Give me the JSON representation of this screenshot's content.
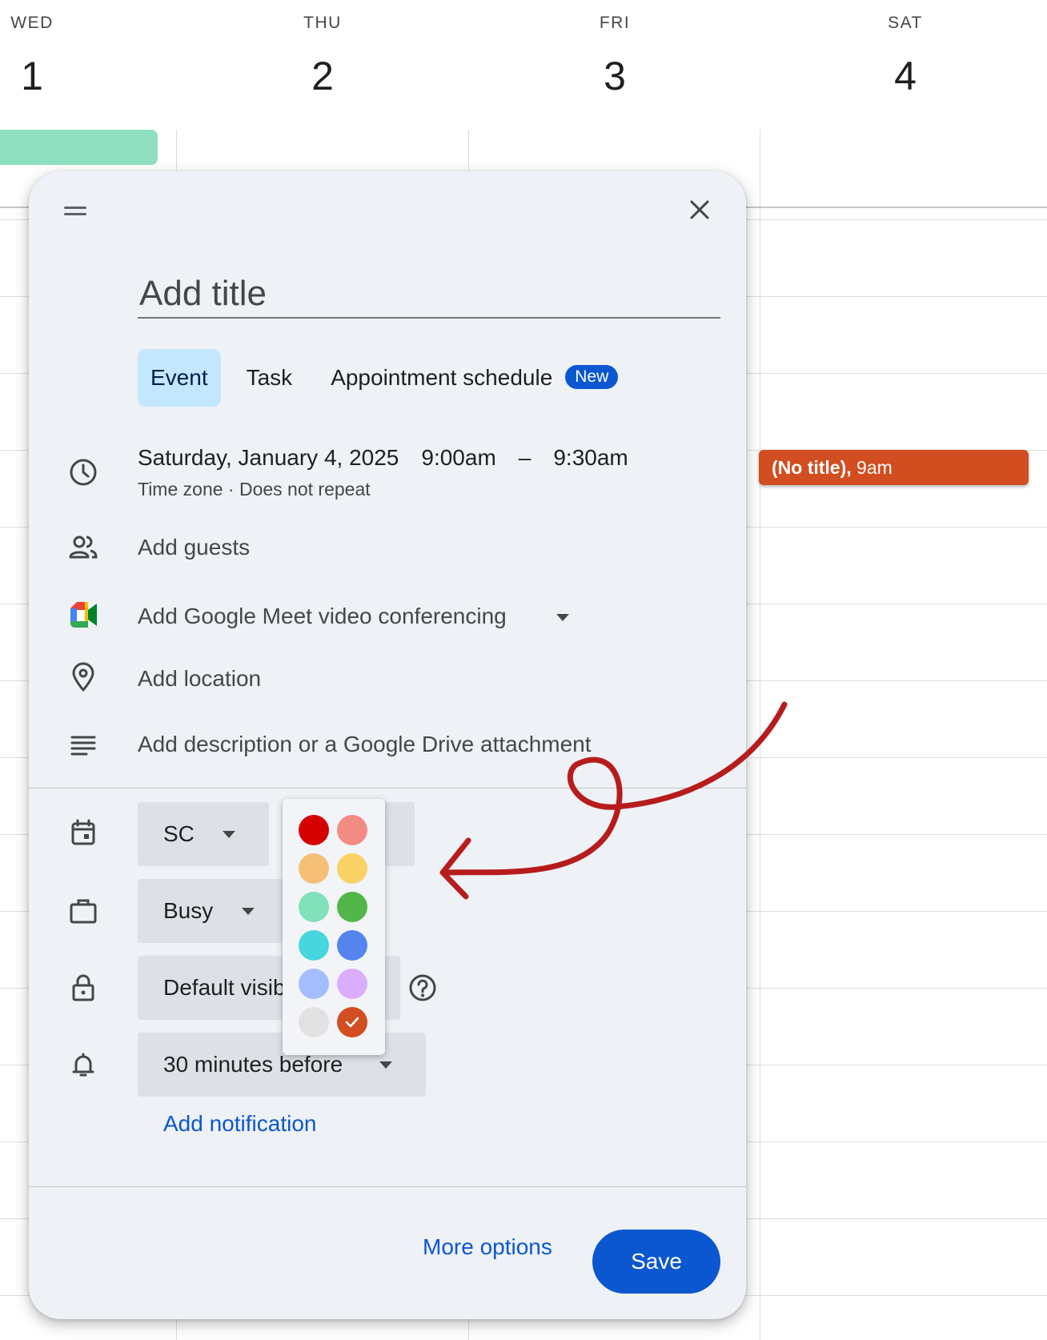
{
  "calendar": {
    "days": [
      {
        "name": "WED",
        "num": "1"
      },
      {
        "name": "THU",
        "num": "2"
      },
      {
        "name": "FRI",
        "num": "3"
      },
      {
        "name": "SAT",
        "num": "4"
      }
    ],
    "sat_event": {
      "title": "(No title),",
      "time": "9am",
      "color": "#d24d1f"
    }
  },
  "dialog": {
    "title_placeholder": "Add title",
    "tabs": [
      {
        "label": "Event",
        "active": true
      },
      {
        "label": "Task",
        "active": false
      },
      {
        "label": "Appointment schedule",
        "active": false
      }
    ],
    "new_badge": "New",
    "date": "Saturday, January 4, 2025",
    "start_time": "9:00am",
    "dash": "–",
    "end_time": "9:30am",
    "sub_line": "Time zone · Does not repeat",
    "add_guests": "Add guests",
    "meet": "Add Google Meet video conferencing",
    "location": "Add location",
    "description": "Add description or a Google Drive attachment",
    "calendar_select": "SC",
    "busy_select": "Busy",
    "visibility_select": "Default visibility",
    "notification_select": "30 minutes before",
    "add_notification": "Add notification",
    "more_options": "More options",
    "save": "Save"
  },
  "color_picker": {
    "selected": "tangerine",
    "colors": [
      "#d50000",
      "#f28b82",
      "#f6bf76",
      "#fad165",
      "#81e1b8",
      "#51b749",
      "#46d6db",
      "#5484ed",
      "#a4bdfc",
      "#dbadff",
      "#e1e1e1",
      "#d24d1f"
    ]
  },
  "annotation": {
    "color": "#b71c1c"
  }
}
